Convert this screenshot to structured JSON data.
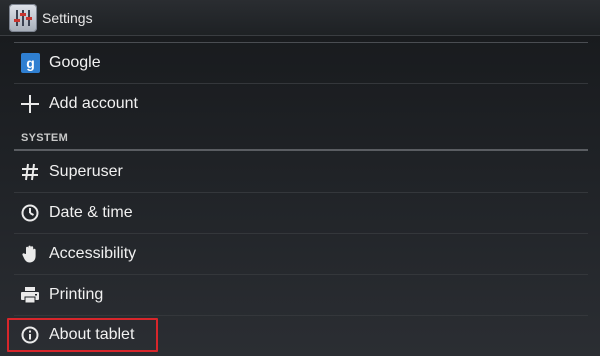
{
  "actionbar": {
    "title": "Settings",
    "icon": "equalizer-settings-icon"
  },
  "accounts": {
    "items": [
      {
        "label": "Google",
        "icon": "google-icon"
      },
      {
        "label": "Add account",
        "icon": "plus-icon"
      }
    ]
  },
  "system": {
    "header": "SYSTEM",
    "items": [
      {
        "label": "Superuser",
        "icon": "hash-icon"
      },
      {
        "label": "Date & time",
        "icon": "clock-icon"
      },
      {
        "label": "Accessibility",
        "icon": "hand-icon"
      },
      {
        "label": "Printing",
        "icon": "printer-icon"
      },
      {
        "label": "About tablet",
        "icon": "info-icon"
      }
    ]
  },
  "colors": {
    "google_badge": "#2f7fd1",
    "highlight_border": "#d8262b"
  }
}
